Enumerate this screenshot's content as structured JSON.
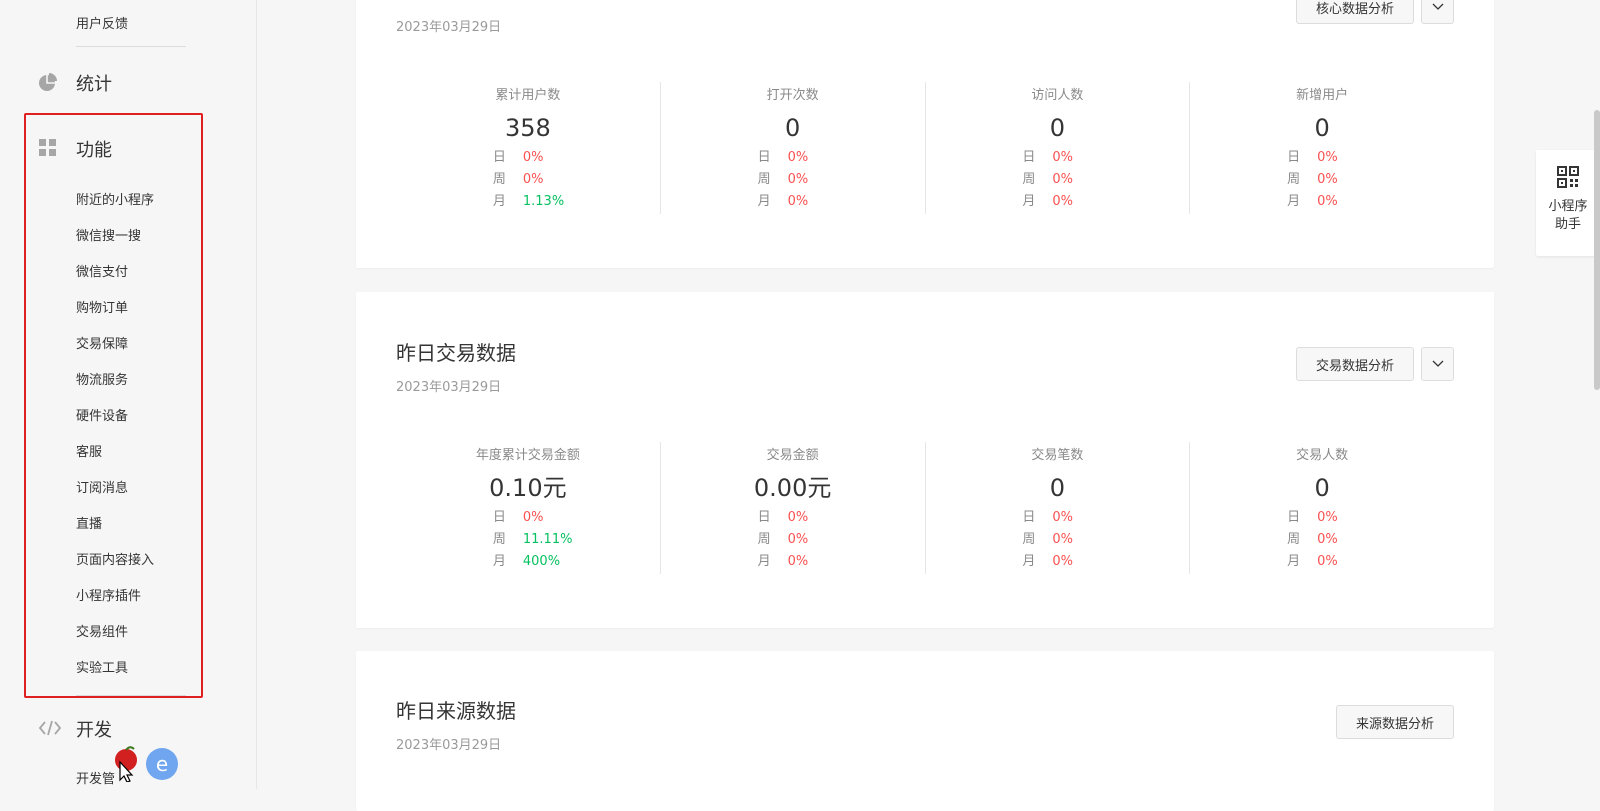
{
  "sidebar": {
    "top_item": "用户反馈",
    "stats_group": "统计",
    "func_group": "功能",
    "func_items": [
      "附近的小程序",
      "微信搜一搜",
      "微信支付",
      "购物订单",
      "交易保障",
      "物流服务",
      "硬件设备",
      "客服",
      "订阅消息",
      "直播",
      "页面内容接入",
      "小程序插件",
      "交易组件",
      "实验工具"
    ],
    "dev_group": "开发",
    "dev_item": "开发管"
  },
  "cards": [
    {
      "title": "",
      "date": "2023年03月29日",
      "button": "核心数据分析",
      "stats": [
        {
          "label": "累计用户数",
          "value": "358",
          "rows": [
            {
              "k": "日",
              "v": "0%",
              "color": "red"
            },
            {
              "k": "周",
              "v": "0%",
              "color": "red"
            },
            {
              "k": "月",
              "v": "1.13%",
              "color": "green"
            }
          ]
        },
        {
          "label": "打开次数",
          "value": "0",
          "rows": [
            {
              "k": "日",
              "v": "0%",
              "color": "red"
            },
            {
              "k": "周",
              "v": "0%",
              "color": "red"
            },
            {
              "k": "月",
              "v": "0%",
              "color": "red"
            }
          ]
        },
        {
          "label": "访问人数",
          "value": "0",
          "rows": [
            {
              "k": "日",
              "v": "0%",
              "color": "red"
            },
            {
              "k": "周",
              "v": "0%",
              "color": "red"
            },
            {
              "k": "月",
              "v": "0%",
              "color": "red"
            }
          ]
        },
        {
          "label": "新增用户",
          "value": "0",
          "rows": [
            {
              "k": "日",
              "v": "0%",
              "color": "red"
            },
            {
              "k": "周",
              "v": "0%",
              "color": "red"
            },
            {
              "k": "月",
              "v": "0%",
              "color": "red"
            }
          ]
        }
      ]
    },
    {
      "title": "昨日交易数据",
      "date": "2023年03月29日",
      "button": "交易数据分析",
      "stats": [
        {
          "label": "年度累计交易金额",
          "value": "0.10元",
          "rows": [
            {
              "k": "日",
              "v": "0%",
              "color": "red"
            },
            {
              "k": "周",
              "v": "11.11%",
              "color": "green"
            },
            {
              "k": "月",
              "v": "400%",
              "color": "green"
            }
          ]
        },
        {
          "label": "交易金额",
          "value": "0.00元",
          "rows": [
            {
              "k": "日",
              "v": "0%",
              "color": "red"
            },
            {
              "k": "周",
              "v": "0%",
              "color": "red"
            },
            {
              "k": "月",
              "v": "0%",
              "color": "red"
            }
          ]
        },
        {
          "label": "交易笔数",
          "value": "0",
          "rows": [
            {
              "k": "日",
              "v": "0%",
              "color": "red"
            },
            {
              "k": "周",
              "v": "0%",
              "color": "red"
            },
            {
              "k": "月",
              "v": "0%",
              "color": "red"
            }
          ]
        },
        {
          "label": "交易人数",
          "value": "0",
          "rows": [
            {
              "k": "日",
              "v": "0%",
              "color": "red"
            },
            {
              "k": "周",
              "v": "0%",
              "color": "red"
            },
            {
              "k": "月",
              "v": "0%",
              "color": "red"
            }
          ]
        }
      ]
    },
    {
      "title": "昨日来源数据",
      "date": "2023年03月29日",
      "button": "来源数据分析"
    }
  ],
  "helper": {
    "line1": "小程序",
    "line2": "助手"
  },
  "colors": {
    "red": "#fa5151",
    "green": "#07c160",
    "highlight": "#e02020"
  }
}
